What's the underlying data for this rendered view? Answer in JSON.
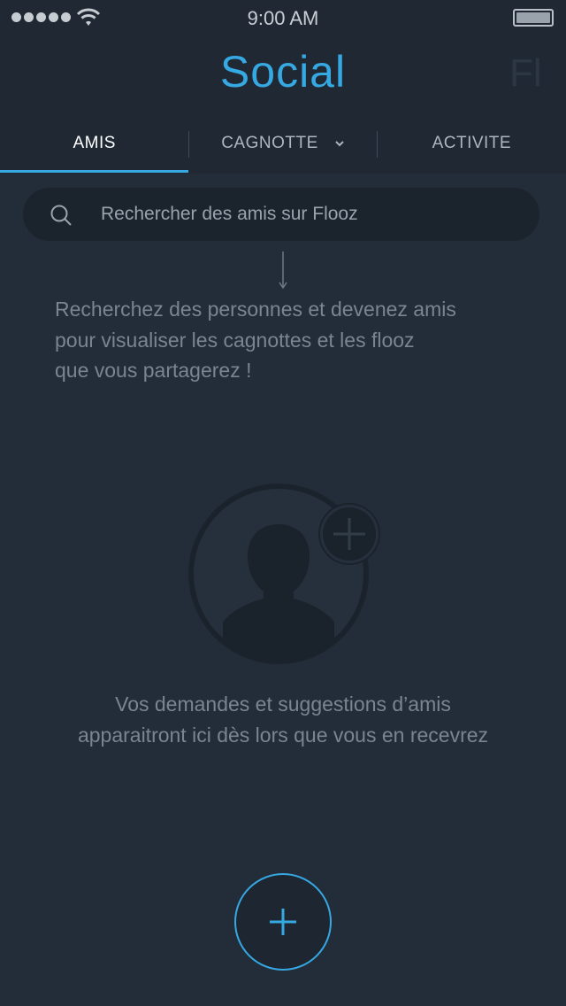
{
  "status_bar": {
    "time": "9:00 AM",
    "signal_icon": "signal-dots-icon",
    "wifi_icon": "wifi-icon",
    "battery_icon": "battery-icon"
  },
  "header": {
    "title": "Social",
    "next_title_peek": "Fl"
  },
  "tabs": [
    {
      "label": "AMIS",
      "active": true
    },
    {
      "label": "CAGNOTTE",
      "active": false,
      "icon": "chevron-down-icon"
    },
    {
      "label": "ACTIVITE",
      "active": false
    }
  ],
  "search": {
    "placeholder": "Rechercher des amis sur Flooz",
    "icon": "search-icon"
  },
  "hint": {
    "lines": [
      "Recherchez des personnes et devenez amis",
      "pour visualiser les cagnottes et les flooz",
      "que vous partagerez !"
    ]
  },
  "empty_state": {
    "illustration": "add-friend-icon",
    "lines": [
      "Vos demandes et suggestions d’amis",
      "apparaitront ici dès lors que vous en recevrez"
    ]
  },
  "fab": {
    "icon": "plus-icon"
  },
  "colors": {
    "accent": "#36a8e2",
    "background": "#232d3a",
    "header": "#1f2833",
    "muted_text": "#7a8591"
  }
}
